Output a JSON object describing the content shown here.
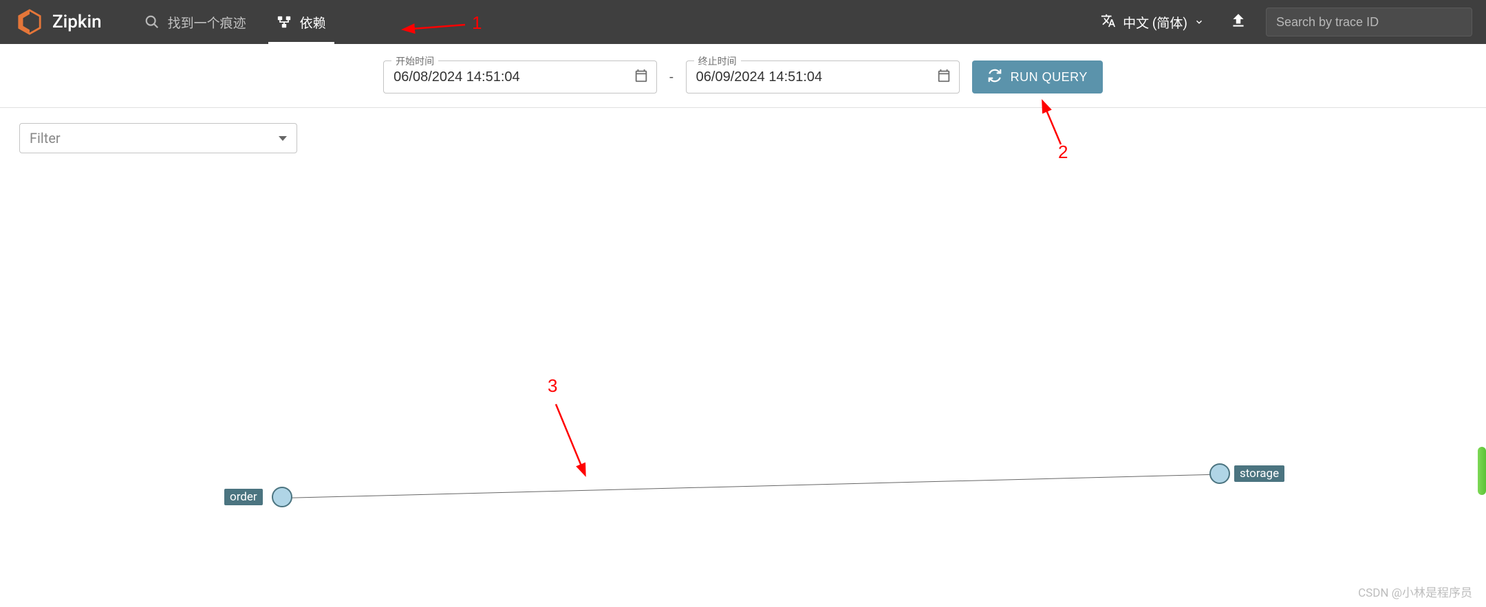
{
  "header": {
    "brand": "Zipkin",
    "nav": {
      "search": {
        "label": "找到一个痕迹"
      },
      "deps": {
        "label": "依赖"
      }
    },
    "language": "中文 (简体)",
    "search_placeholder": "Search by trace ID"
  },
  "query": {
    "start_label": "开始时间",
    "start_value": "06/08/2024 14:51:04",
    "end_label": "终止时间",
    "end_value": "06/09/2024 14:51:04",
    "dash": "-",
    "run_label": "RUN QUERY"
  },
  "filter": {
    "placeholder": "Filter"
  },
  "graph": {
    "nodes": [
      {
        "id": "order",
        "label": "order"
      },
      {
        "id": "storage",
        "label": "storage"
      }
    ],
    "edges": [
      {
        "from": "order",
        "to": "storage"
      }
    ]
  },
  "annotations": {
    "a1": "1",
    "a2": "2",
    "a3": "3"
  },
  "watermark": "CSDN @小林是程序员"
}
